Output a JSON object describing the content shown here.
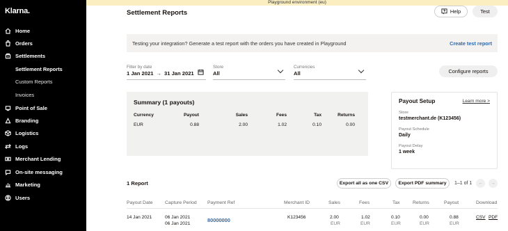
{
  "banner": "Playground environment (eu)",
  "sidebar": {
    "logo": "Klarna.",
    "items": [
      {
        "label": "Home",
        "icon": "home-icon"
      },
      {
        "label": "Orders",
        "icon": "orders-icon"
      },
      {
        "label": "Settlements",
        "icon": "settlements-icon",
        "active": true
      },
      {
        "label": "Point of Sale",
        "icon": "pos-icon"
      },
      {
        "label": "Branding",
        "icon": "branding-icon"
      },
      {
        "label": "Logistics",
        "icon": "logistics-icon"
      },
      {
        "label": "Logs",
        "icon": "logs-icon"
      },
      {
        "label": "Merchant Lending",
        "icon": "lending-icon"
      },
      {
        "label": "On-site messaging",
        "icon": "messaging-icon"
      },
      {
        "label": "Marketing",
        "icon": "marketing-icon"
      },
      {
        "label": "Users",
        "icon": "users-icon"
      }
    ],
    "subitems": [
      {
        "label": "Settlement Reports",
        "active": true
      },
      {
        "label": "Custom Reports"
      },
      {
        "label": "Invoices"
      }
    ]
  },
  "header": {
    "title": "Settlement Reports",
    "help_label": "Help",
    "test_label": "Test"
  },
  "notice": {
    "text": "Testing your integration? Generate a test report with the orders you have created in Playground",
    "link": "Create test report"
  },
  "filters": {
    "date": {
      "label": "Filter by date",
      "from": "1 Jan 2021",
      "arrow": "→",
      "to": "31 Jan 2021"
    },
    "store": {
      "label": "Store",
      "value": "All"
    },
    "currencies": {
      "label": "Currencies",
      "value": "All"
    },
    "configure_label": "Configure reports"
  },
  "summary": {
    "title": "Summary (1 payouts)",
    "headers": [
      "Currency",
      "Payout",
      "Sales",
      "Fees",
      "Tax",
      "Returns"
    ],
    "row": [
      "EUR",
      "0.88",
      "2.00",
      "1.02",
      "0.10",
      "0.00"
    ]
  },
  "payout_setup": {
    "title": "Payout Setup",
    "learn_more": "Learn more >",
    "store_label": "Store",
    "store_value": "testmerchant.de (K123456)",
    "schedule_label": "Payout Schedule",
    "schedule_value": "Daily",
    "delay_label": "Payout Delay",
    "delay_value": "1 week"
  },
  "reports": {
    "count": "1 Report",
    "export_csv": "Export all as one CSV",
    "export_pdf": "Export PDF summary",
    "pager": "1–1 of 1",
    "columns": [
      "Payout Date",
      "Capture Period",
      "Payment Ref",
      "Merchant ID",
      "Sales",
      "Fees",
      "Tax",
      "Returns",
      "Payout",
      "Download"
    ],
    "rows": [
      {
        "payout_date": "14 Jan 2021",
        "capture_from": "06 Jan 2021",
        "capture_to": "06 Jan 2021",
        "payment_ref": "80000000",
        "merchant_id": "K123456",
        "sales": "2.00",
        "fees": "1.02",
        "tax": "0.10",
        "returns": "0.00",
        "payout": "0.88",
        "currency": "EUR",
        "dl_csv": "CSV",
        "dl_pdf": "PDF"
      }
    ]
  }
}
